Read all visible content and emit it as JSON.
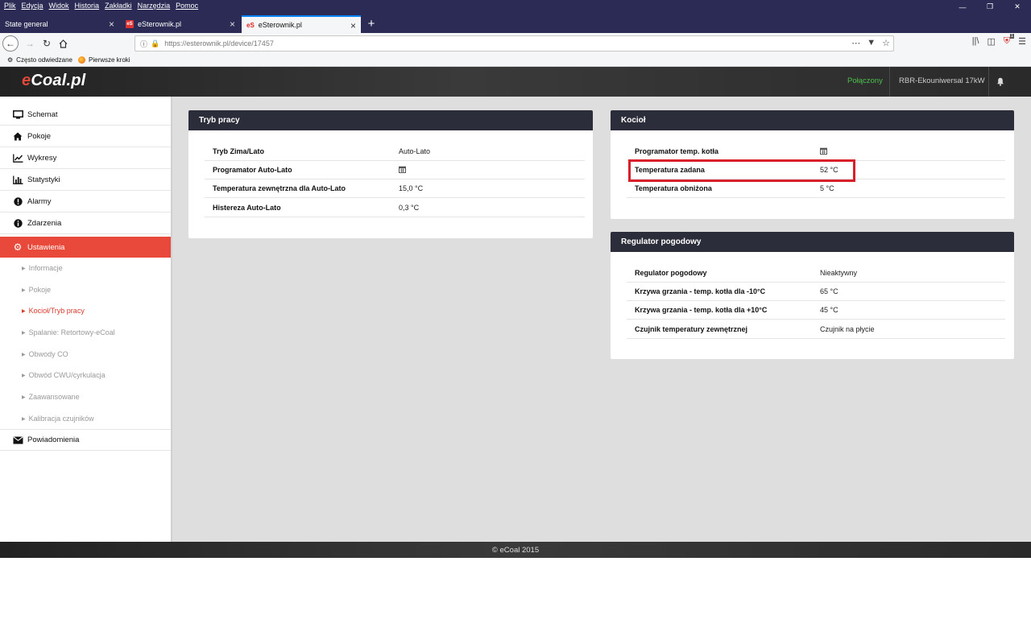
{
  "browser": {
    "menu": [
      "Plik",
      "Edycja",
      "Widok",
      "Historia",
      "Zakładki",
      "Narzędzia",
      "Pomoc"
    ],
    "tabs": [
      {
        "label": "State general",
        "active": false
      },
      {
        "label": "eSterownik.pl",
        "active": false
      },
      {
        "label": "eSterownik.pl",
        "active": true
      }
    ],
    "url_host": "https://esterownik.pl",
    "url_path": "/device/17457",
    "bookmarks": [
      "Często odwiedzane",
      "Pierwsze kroki"
    ],
    "notification_count": "1"
  },
  "app": {
    "logo_e": "e",
    "logo_rest": "Coal.pl",
    "status": "Połączony",
    "device": "RBR-Ekouniwersal 17kW",
    "accent_color": "#e8493a",
    "status_color": "#4cc04c"
  },
  "sidebar": {
    "items": [
      {
        "label": "Schemat",
        "icon": "monitor-icon"
      },
      {
        "label": "Pokoje",
        "icon": "home-icon"
      },
      {
        "label": "Wykresy",
        "icon": "line-chart-icon"
      },
      {
        "label": "Statystyki",
        "icon": "bar-chart-icon"
      },
      {
        "label": "Alarmy",
        "icon": "alert-icon"
      },
      {
        "label": "Zdarzenia",
        "icon": "info-icon"
      },
      {
        "label": "Ustawienia",
        "icon": "gear-icon",
        "active": true
      },
      {
        "label": "Powiadomienia",
        "icon": "envelope-icon"
      }
    ],
    "subitems": [
      {
        "label": "Informacje"
      },
      {
        "label": "Pokoje"
      },
      {
        "label": "Kocioł/Tryb pracy",
        "active": true
      },
      {
        "label": "Spalanie: Retortowy-eCoal"
      },
      {
        "label": "Obwody CO"
      },
      {
        "label": "Obwód CWU/cyrkulacja"
      },
      {
        "label": "Zaawansowane"
      },
      {
        "label": "Kalibracja czujników"
      }
    ]
  },
  "panels": {
    "tryb": {
      "title": "Tryb pracy",
      "rows": [
        {
          "label": "Tryb Zima/Lato",
          "value": "Auto-Lato"
        },
        {
          "label": "Programator Auto-Lato",
          "value": "",
          "icon": "calendar-icon"
        },
        {
          "label": "Temperatura zewnętrzna dla Auto-Lato",
          "value": "15,0 °C"
        },
        {
          "label": "Histereza Auto-Lato",
          "value": "0,3 °C"
        }
      ]
    },
    "kociol": {
      "title": "Kocioł",
      "rows": [
        {
          "label": "Programator temp. kotła",
          "value": "",
          "icon": "calendar-icon"
        },
        {
          "label": "Temperatura zadana",
          "value": "52 °C"
        },
        {
          "label": "Temperatura obniżona",
          "value": "5 °C"
        }
      ]
    },
    "regulator": {
      "title": "Regulator pogodowy",
      "rows": [
        {
          "label": "Regulator pogodowy",
          "value": "Nieaktywny"
        },
        {
          "label": "Krzywa grzania - temp. kotła dla -10°C",
          "value": "65 °C"
        },
        {
          "label": "Krzywa grzania - temp. kotła dla +10°C",
          "value": "45 °C"
        },
        {
          "label": "Czujnik temperatury zewnętrznej",
          "value": "Czujnik na płycie"
        }
      ]
    }
  },
  "footer": "© eCoal 2015"
}
